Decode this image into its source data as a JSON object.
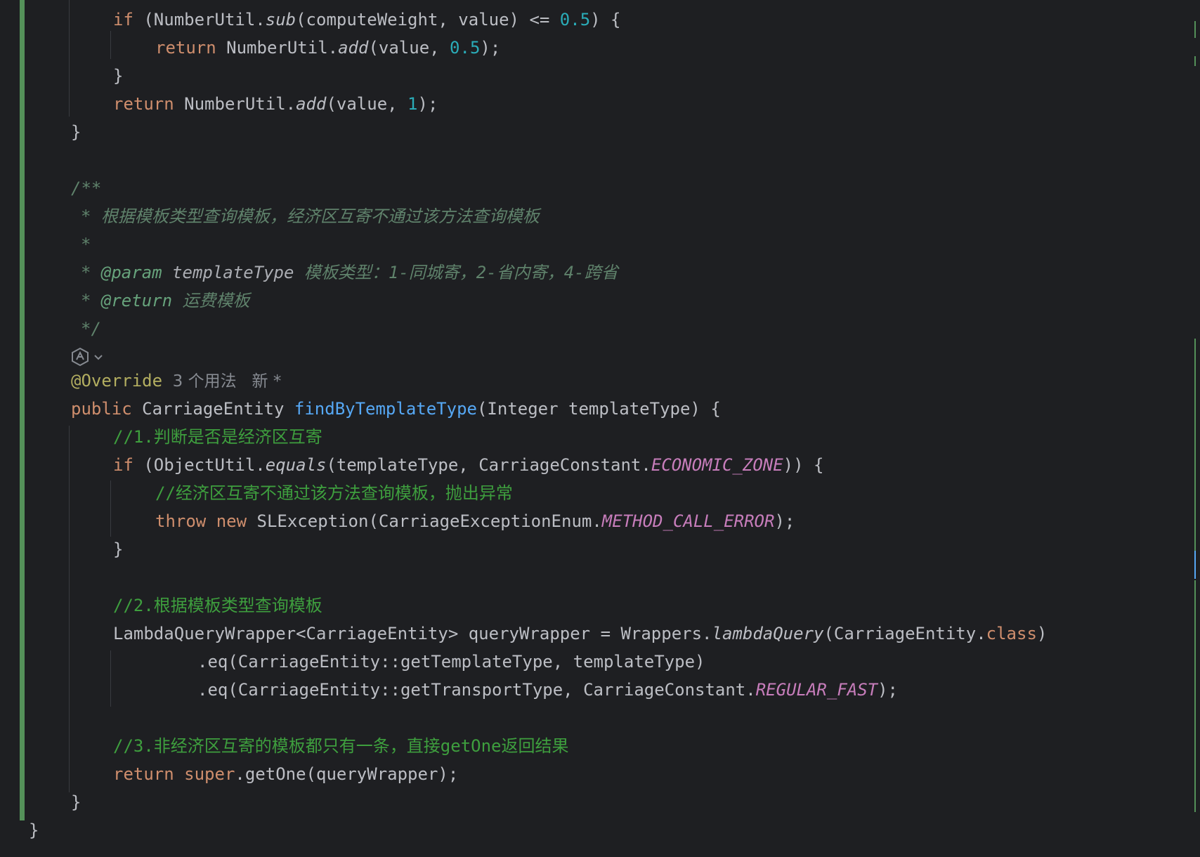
{
  "editor": {
    "lines": [
      [
        {
          "t": "if",
          "c": "kw"
        },
        {
          "t": " (NumberUtil."
        },
        {
          "t": "sub",
          "c": "it"
        },
        {
          "t": "(computeWeight, value) <= "
        },
        {
          "t": "0.5",
          "c": "num"
        },
        {
          "t": ") {"
        }
      ],
      [
        {
          "t": "return",
          "c": "kw"
        },
        {
          "t": " NumberUtil."
        },
        {
          "t": "add",
          "c": "it"
        },
        {
          "t": "(value, "
        },
        {
          "t": "0.5",
          "c": "num"
        },
        {
          "t": ");"
        }
      ],
      [
        {
          "t": "}"
        }
      ],
      [
        {
          "t": "return",
          "c": "kw"
        },
        {
          "t": " NumberUtil."
        },
        {
          "t": "add",
          "c": "it"
        },
        {
          "t": "(value, "
        },
        {
          "t": "1",
          "c": "num"
        },
        {
          "t": ");"
        }
      ],
      [
        {
          "t": "}"
        }
      ],
      [
        {
          "t": "/**",
          "c": "doc"
        }
      ],
      [
        {
          "t": "* 根据模板类型查询模板，经济区互寄不通过该方法查询模板",
          "c": "doc"
        }
      ],
      [
        {
          "t": "*",
          "c": "doc"
        }
      ],
      [
        {
          "t": "* ",
          "c": "doc"
        },
        {
          "t": "@param",
          "c": "doctag"
        },
        {
          "t": " templateType",
          "c": "docparam"
        },
        {
          "t": " 模板类型：1-同城寄，2-省内寄，4-跨省",
          "c": "doc"
        }
      ],
      [
        {
          "t": "* ",
          "c": "doc"
        },
        {
          "t": "@return",
          "c": "doctag"
        },
        {
          "t": " 运费模板",
          "c": "doc"
        }
      ],
      [
        {
          "t": "*/",
          "c": "doc"
        }
      ],
      [
        {
          "t": "@Override",
          "c": "anno"
        },
        {
          "t": "  3 个用法   新 *",
          "c": "hint"
        }
      ],
      [
        {
          "t": "public",
          "c": "kw"
        },
        {
          "t": " CarriageEntity "
        },
        {
          "t": "findByTemplateType",
          "c": "fn"
        },
        {
          "t": "(Integer templateType) {"
        }
      ],
      [
        {
          "t": "//1.判断是否是经济区互寄",
          "c": "cmt"
        }
      ],
      [
        {
          "t": "if",
          "c": "kw"
        },
        {
          "t": " (ObjectUtil."
        },
        {
          "t": "equals",
          "c": "it"
        },
        {
          "t": "(templateType, CarriageConstant."
        },
        {
          "t": "ECONOMIC_ZONE",
          "c": "const"
        },
        {
          "t": ")) {"
        }
      ],
      [
        {
          "t": "//经济区互寄不通过该方法查询模板，抛出异常",
          "c": "cmt"
        }
      ],
      [
        {
          "t": "throw",
          "c": "kw"
        },
        {
          "t": " "
        },
        {
          "t": "new",
          "c": "kw"
        },
        {
          "t": " SLException(CarriageExceptionEnum."
        },
        {
          "t": "METHOD_CALL_ERROR",
          "c": "const"
        },
        {
          "t": ");"
        }
      ],
      [
        {
          "t": "}"
        }
      ],
      [
        {
          "t": "//2.根据模板类型查询模板",
          "c": "cmt"
        }
      ],
      [
        {
          "t": "LambdaQueryWrapper<CarriageEntity> queryWrapper = Wrappers."
        },
        {
          "t": "lambdaQuery",
          "c": "it"
        },
        {
          "t": "(CarriageEntity."
        },
        {
          "t": "class",
          "c": "kw"
        },
        {
          "t": ")"
        }
      ],
      [
        {
          "t": ".eq(CarriageEntity::getTemplateType, templateType)"
        }
      ],
      [
        {
          "t": ".eq(CarriageEntity::getTransportType, CarriageConstant."
        },
        {
          "t": "REGULAR_FAST",
          "c": "const"
        },
        {
          "t": ");"
        }
      ],
      [
        {
          "t": "//3.非经济区互寄的模板都只有一条，直接getOne返回结果",
          "c": "cmt"
        }
      ],
      [
        {
          "t": "return",
          "c": "kw"
        },
        {
          "t": " "
        },
        {
          "t": "super",
          "c": "kw"
        },
        {
          "t": ".getOne(queryWrapper);"
        }
      ],
      [
        {
          "t": "}"
        }
      ],
      [
        {
          "t": "}"
        }
      ]
    ],
    "ai_icon": "ai-assistant-icon",
    "fold_icon": "chevron-down-icon"
  },
  "colors": {
    "background": "#1e1f22",
    "keyword": "#cf8e6d",
    "number": "#2aacb8",
    "method_declaration": "#56a8f5",
    "constant": "#c77dbb",
    "annotation": "#b3ae60",
    "doc_comment": "#5f826b",
    "line_comment": "#3e9f3e",
    "vcs_changed_gutter": "#549159"
  }
}
